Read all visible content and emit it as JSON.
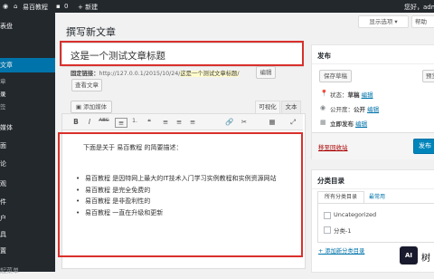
{
  "admin_bar": {
    "site_name": "易百教程",
    "comments_count": "0",
    "new_label": "+ 新建",
    "greeting": "您好，adm"
  },
  "sidebar": {
    "top_label": "表盘",
    "items": [
      {
        "label": "文章"
      },
      {
        "label": "所有文章"
      },
      {
        "label": "写文章"
      },
      {
        "label": "分类目录"
      },
      {
        "label": "标签"
      },
      {
        "label": "媒体"
      },
      {
        "label": "页面"
      },
      {
        "label": "评论"
      },
      {
        "label": "外观"
      },
      {
        "label": "插件"
      },
      {
        "label": "用户"
      },
      {
        "label": "工具"
      },
      {
        "label": "设置"
      },
      {
        "label": "收起菜单"
      }
    ],
    "visible_fragments": [
      "表盘",
      "文章",
      "章",
      "录",
      "签",
      "媒体",
      "面",
      "论",
      "观",
      "件",
      "户",
      "具",
      "置",
      "起菜单"
    ]
  },
  "screen_options": "显示选项",
  "help": "帮助",
  "page_title": "撰写新文章",
  "post_title": "这是一个测试文章标题",
  "permalink": {
    "label": "固定链接：",
    "url_prefix": "http://127.0.0.1/2015/10/24/",
    "slug": "这是一个测试文章标题/",
    "edit_label": "编辑",
    "view_label": "查看文章"
  },
  "add_media": "添加媒体",
  "editor_tabs": {
    "visual": "可视化",
    "text": "文本"
  },
  "toolbar_icons": [
    "B",
    "I",
    "ABC",
    "≡",
    "1.",
    "❝",
    "≡",
    "≡",
    "≡",
    "🔗",
    "✂",
    "▦",
    "⤢"
  ],
  "content": {
    "intro": "下面是关于 易百教程 的简要描述：",
    "bullets": [
      "易百教程 是因特网上最大的IT技术入门学习实例教程和实例资源网站",
      "易百教程 是完全免费的",
      "易百教程 是非盈利性的",
      "易百教程 一直在升级和更新"
    ]
  },
  "publish_box": {
    "title": "发布",
    "save_draft": "保存草稿",
    "preview": "预览",
    "status": "状态：",
    "status_value": "草稿",
    "status_edit": "编辑",
    "visibility": "公开度：",
    "visibility_value": "公开",
    "visibility_edit": "编辑",
    "schedule": "立即发布",
    "schedule_edit": "编辑",
    "trash": "移至回收站",
    "publish": "发布"
  },
  "category_box": {
    "title": "分类目录",
    "tab_all": "所有分类目录",
    "tab_popular": "最常用",
    "categories": [
      "Uncategorized",
      "分类-1"
    ],
    "add_new": "+ 添加新分类目录"
  },
  "watermark": "树",
  "colors": {
    "admin_bg": "#23282d",
    "accent": "#0073aa",
    "highlight_red": "#d9302c",
    "link_orange": "#d54e21"
  }
}
